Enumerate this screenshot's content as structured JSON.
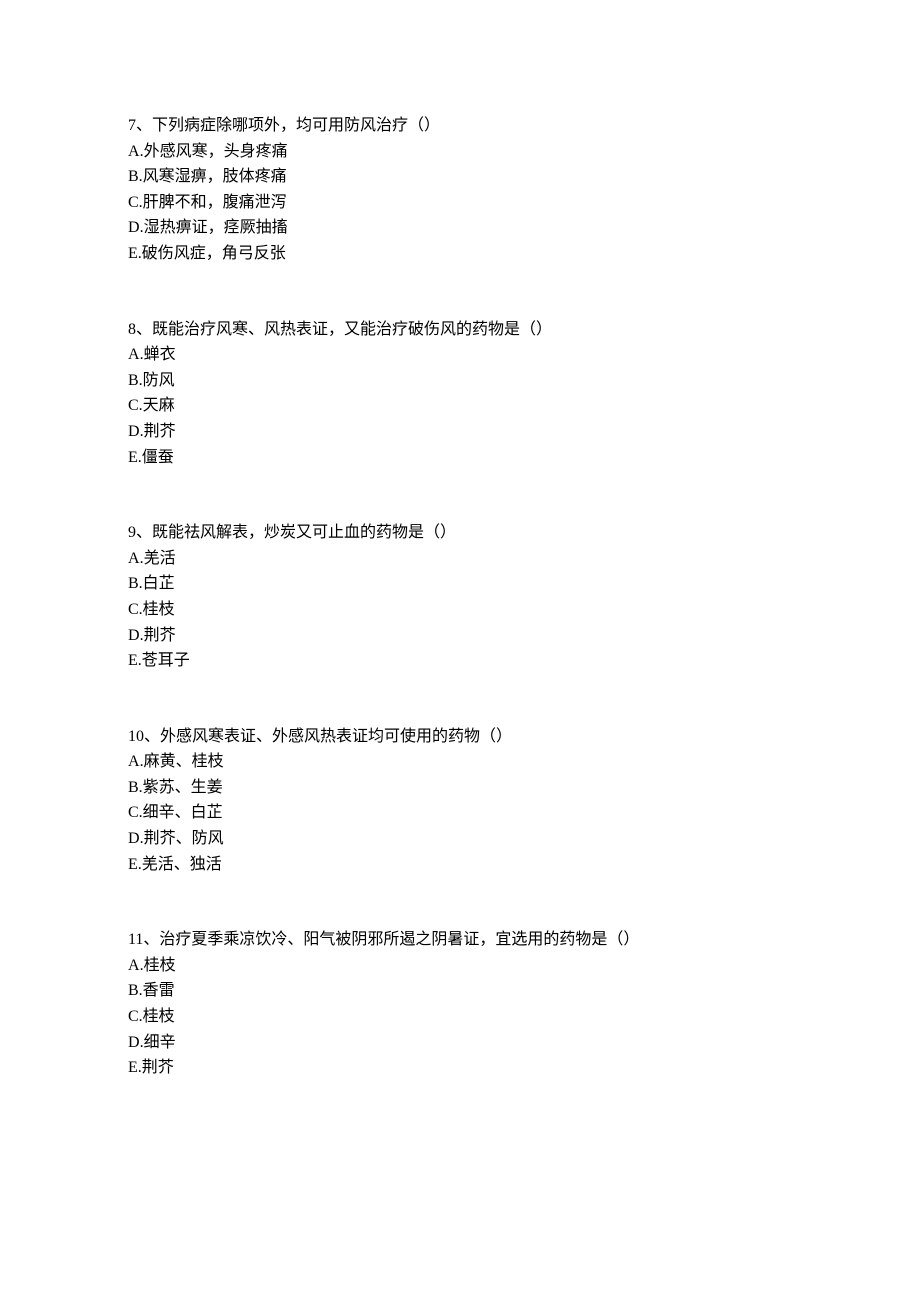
{
  "questions": [
    {
      "number": "7",
      "text": "下列病症除哪项外，均可用防风治疗（）",
      "options": [
        {
          "label": "A",
          "text": "外感风寒，头身疼痛"
        },
        {
          "label": "B",
          "text": "风寒湿痹，肢体疼痛"
        },
        {
          "label": "C",
          "text": "肝脾不和，腹痛泄泻"
        },
        {
          "label": "D",
          "text": "湿热痹证，痉厥抽搐"
        },
        {
          "label": "E",
          "text": "破伤风症，角弓反张"
        }
      ]
    },
    {
      "number": "8",
      "text": "既能治疗风寒、风热表证，又能治疗破伤风的药物是（）",
      "options": [
        {
          "label": "A",
          "text": "蝉衣"
        },
        {
          "label": "B",
          "text": "防风"
        },
        {
          "label": "C",
          "text": "天麻"
        },
        {
          "label": "D",
          "text": "荆芥"
        },
        {
          "label": "E",
          "text": "僵蚕"
        }
      ]
    },
    {
      "number": "9",
      "text": "既能祛风解表，炒炭又可止血的药物是（）",
      "options": [
        {
          "label": "A",
          "text": "羌活"
        },
        {
          "label": "B",
          "text": "白芷"
        },
        {
          "label": "C",
          "text": "桂枝"
        },
        {
          "label": "D",
          "text": "荆芥"
        },
        {
          "label": "E",
          "text": "苍耳子"
        }
      ]
    },
    {
      "number": "10",
      "text": "外感风寒表证、外感风热表证均可使用的药物（）",
      "options": [
        {
          "label": "A",
          "text": "麻黄、桂枝"
        },
        {
          "label": "B",
          "text": "紫苏、生姜"
        },
        {
          "label": "C",
          "text": "细辛、白芷"
        },
        {
          "label": "D",
          "text": "荆芥、防风"
        },
        {
          "label": "E",
          "text": "羌活、独活"
        }
      ]
    },
    {
      "number": "11",
      "text": "治疗夏季乘凉饮冷、阳气被阴邪所遏之阴暑证，宜选用的药物是（）",
      "options": [
        {
          "label": "A",
          "text": "桂枝"
        },
        {
          "label": "B",
          "text": "香雷"
        },
        {
          "label": "C",
          "text": "桂枝"
        },
        {
          "label": "D",
          "text": "细辛"
        },
        {
          "label": "E",
          "text": "荆芥"
        }
      ]
    }
  ]
}
